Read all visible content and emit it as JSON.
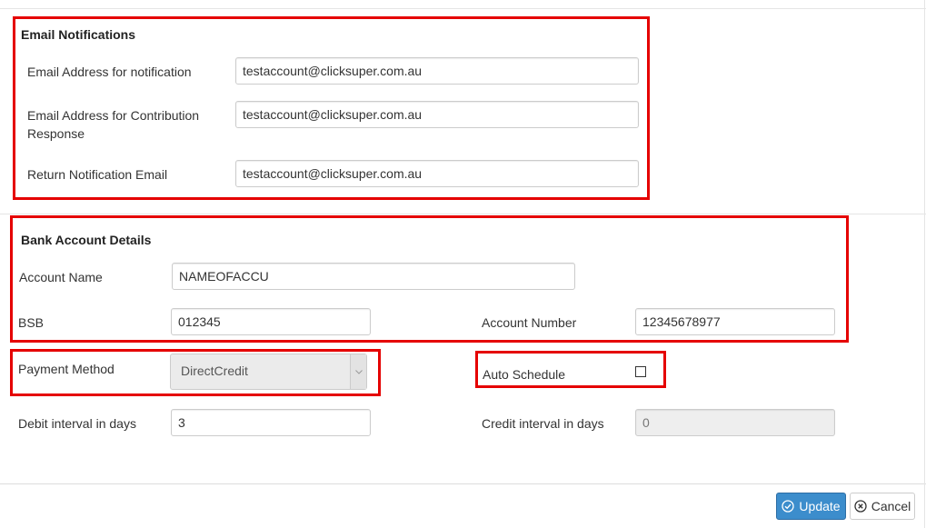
{
  "email_notifications": {
    "title": "Email Notifications",
    "notification_label": "Email Address for notification",
    "notification_value": "testaccount@clicksuper.com.au",
    "contribution_label_line1": "Email Address for Contribution",
    "contribution_label_line2": "Response",
    "contribution_value": "testaccount@clicksuper.com.au",
    "return_label": "Return Notification Email",
    "return_value": "testaccount@clicksuper.com.au"
  },
  "bank_account": {
    "title": "Bank Account Details",
    "account_name_label": "Account Name",
    "account_name_value": "NAMEOFACCU",
    "bsb_label": "BSB",
    "bsb_value": "012345",
    "account_number_label": "Account Number",
    "account_number_value": "12345678977"
  },
  "payment": {
    "method_label": "Payment Method",
    "method_value": "DirectCredit",
    "auto_schedule_label": "Auto Schedule",
    "auto_schedule_checked": false,
    "debit_interval_label": "Debit interval in days",
    "debit_interval_value": "3",
    "credit_interval_label": "Credit interval in days",
    "credit_interval_value": "0"
  },
  "footer": {
    "update_label": "Update",
    "cancel_label": "Cancel"
  },
  "icons": {
    "update": "check-circle-icon",
    "cancel": "close-circle-icon",
    "select_arrow": "chevron-down-icon"
  },
  "colors": {
    "highlight": "#e50000",
    "primary": "#3c8dcc"
  }
}
